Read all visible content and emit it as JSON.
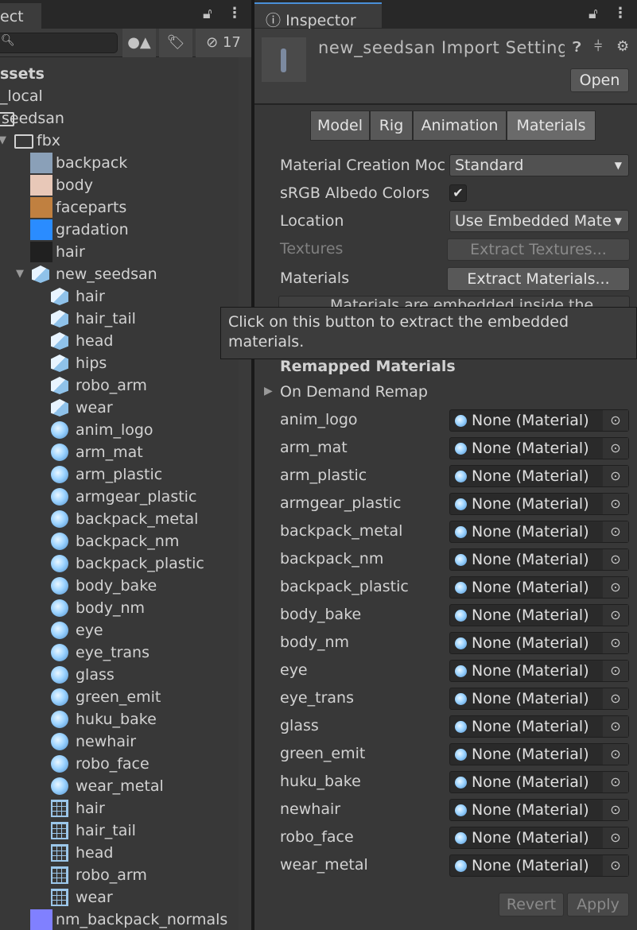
{
  "project": {
    "tab_label": "ect",
    "hidden_count": "17",
    "tree": [
      {
        "label": "ssets",
        "level": 0,
        "icon": "none",
        "bold": true
      },
      {
        "label": "_local",
        "level": 0,
        "icon": "none"
      },
      {
        "label": "seedsan",
        "level": 1,
        "icon": "folder-open-icon"
      },
      {
        "label": "fbx",
        "level": 2,
        "icon": "folder-open-icon",
        "expanded": true
      },
      {
        "label": "backpack",
        "level": 3,
        "icon": "texture-icon",
        "color": "#8aa0b8"
      },
      {
        "label": "body",
        "level": 3,
        "icon": "texture-icon",
        "color": "#e8c8b8"
      },
      {
        "label": "faceparts",
        "level": 3,
        "icon": "texture-icon",
        "color": "#c08040"
      },
      {
        "label": "gradation",
        "level": 3,
        "icon": "texture-icon",
        "color": "#2a8cff"
      },
      {
        "label": "hair",
        "level": 3,
        "icon": "texture-icon",
        "color": "#202020"
      },
      {
        "label": "new_seedsan",
        "level": 3,
        "icon": "model-icon",
        "expanded": true
      },
      {
        "label": "hair",
        "level": 4,
        "icon": "prefab-cube-icon"
      },
      {
        "label": "hair_tail",
        "level": 4,
        "icon": "prefab-cube-icon"
      },
      {
        "label": "head",
        "level": 4,
        "icon": "prefab-cube-icon"
      },
      {
        "label": "hips",
        "level": 4,
        "icon": "prefab-cube-icon"
      },
      {
        "label": "robo_arm",
        "level": 4,
        "icon": "prefab-cube-icon"
      },
      {
        "label": "wear",
        "level": 4,
        "icon": "prefab-cube-icon"
      },
      {
        "label": "anim_logo",
        "level": 4,
        "icon": "material-icon"
      },
      {
        "label": "arm_mat",
        "level": 4,
        "icon": "material-icon"
      },
      {
        "label": "arm_plastic",
        "level": 4,
        "icon": "material-icon"
      },
      {
        "label": "armgear_plastic",
        "level": 4,
        "icon": "material-icon"
      },
      {
        "label": "backpack_metal",
        "level": 4,
        "icon": "material-icon"
      },
      {
        "label": "backpack_nm",
        "level": 4,
        "icon": "material-icon"
      },
      {
        "label": "backpack_plastic",
        "level": 4,
        "icon": "material-icon"
      },
      {
        "label": "body_bake",
        "level": 4,
        "icon": "material-icon"
      },
      {
        "label": "body_nm",
        "level": 4,
        "icon": "material-icon"
      },
      {
        "label": "eye",
        "level": 4,
        "icon": "material-icon"
      },
      {
        "label": "eye_trans",
        "level": 4,
        "icon": "material-icon"
      },
      {
        "label": "glass",
        "level": 4,
        "icon": "material-icon"
      },
      {
        "label": "green_emit",
        "level": 4,
        "icon": "material-icon"
      },
      {
        "label": "huku_bake",
        "level": 4,
        "icon": "material-icon"
      },
      {
        "label": "newhair",
        "level": 4,
        "icon": "material-icon"
      },
      {
        "label": "robo_face",
        "level": 4,
        "icon": "material-icon"
      },
      {
        "label": "wear_metal",
        "level": 4,
        "icon": "material-icon"
      },
      {
        "label": "hair",
        "level": 4,
        "icon": "mesh-grid-icon"
      },
      {
        "label": "hair_tail",
        "level": 4,
        "icon": "mesh-grid-icon"
      },
      {
        "label": "head",
        "level": 4,
        "icon": "mesh-grid-icon"
      },
      {
        "label": "robo_arm",
        "level": 4,
        "icon": "mesh-grid-icon"
      },
      {
        "label": "wear",
        "level": 4,
        "icon": "mesh-grid-icon"
      },
      {
        "label": "nm_backpack_normals",
        "level": 3,
        "icon": "texture-icon",
        "color": "#8080ff"
      }
    ]
  },
  "inspector": {
    "tab_label": "Inspector",
    "title": "new_seedsan Import Setting",
    "open_label": "Open",
    "tabs": [
      "Model",
      "Rig",
      "Animation",
      "Materials"
    ],
    "active_tab": "Materials",
    "props": {
      "creation_mode_label": "Material Creation Moc",
      "creation_mode_value": "Standard",
      "srgb_label": "sRGB Albedo Colors",
      "srgb_checked": true,
      "location_label": "Location",
      "location_value": "Use Embedded Mate",
      "textures_label": "Textures",
      "extract_textures": "Extract Textures...",
      "materials_label": "Materials",
      "extract_materials": "Extract Materials...",
      "info_text": "Materials are embedded inside the"
    },
    "remapped_header": "Remapped Materials",
    "on_demand": "On Demand Remap",
    "materials": [
      "anim_logo",
      "arm_mat",
      "arm_plastic",
      "armgear_plastic",
      "backpack_metal",
      "backpack_nm",
      "backpack_plastic",
      "body_bake",
      "body_nm",
      "eye",
      "eye_trans",
      "glass",
      "green_emit",
      "huku_bake",
      "newhair",
      "robo_face",
      "wear_metal"
    ],
    "none_value": "None (Material)",
    "revert_label": "Revert",
    "apply_label": "Apply"
  },
  "tooltip": "Click on this button to extract the embedded materials.",
  "colors": {
    "accent": "#4a90d9",
    "panel": "#383838"
  }
}
